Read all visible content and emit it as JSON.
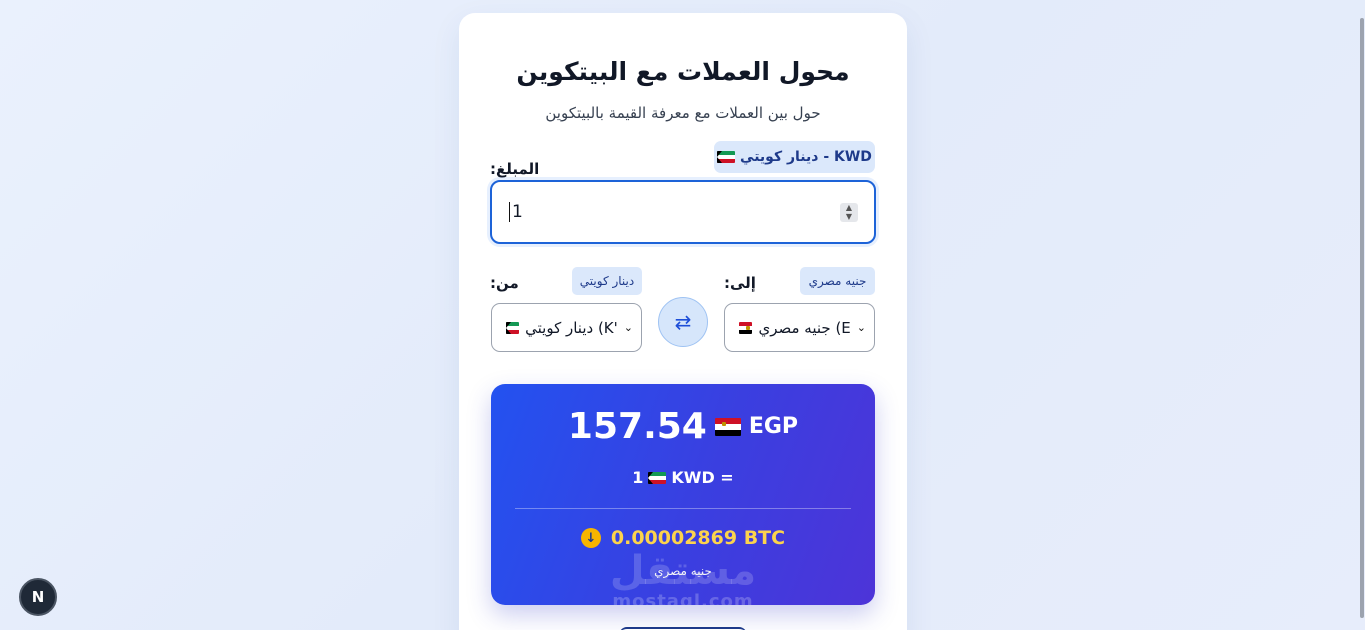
{
  "header": {
    "title": "محول العملات مع البيتكوين",
    "subtitle": "حول بين العملات مع معرفة القيمة بالبيتكوين"
  },
  "amount": {
    "label": ":المبلغ",
    "currency_chip": "دينار كويتي - KWD",
    "value": "1"
  },
  "to": {
    "label": ":إلى",
    "chip": "جنيه مصري",
    "select_value": "جنيه مصري (E"
  },
  "from": {
    "label": ":من",
    "chip": "دينار كويتي",
    "select_value": "دينار كويتي (K'"
  },
  "swap": {
    "icon": "swap-arrows-icon"
  },
  "result": {
    "amount": "157.54",
    "currency": "EGP",
    "equation_value": "1",
    "equation_currency": "KWD =",
    "btc_value": "0.00002869 BTC",
    "btc_note": "جنيه مصري"
  },
  "watermark": {
    "text": "مستقل",
    "domain": "mostaql.com"
  },
  "framework_badge": "N",
  "colors": {
    "accent": "#1d63d8",
    "result_start": "#2352f0",
    "result_end": "#4d34d8",
    "btc": "#fcd34d"
  }
}
